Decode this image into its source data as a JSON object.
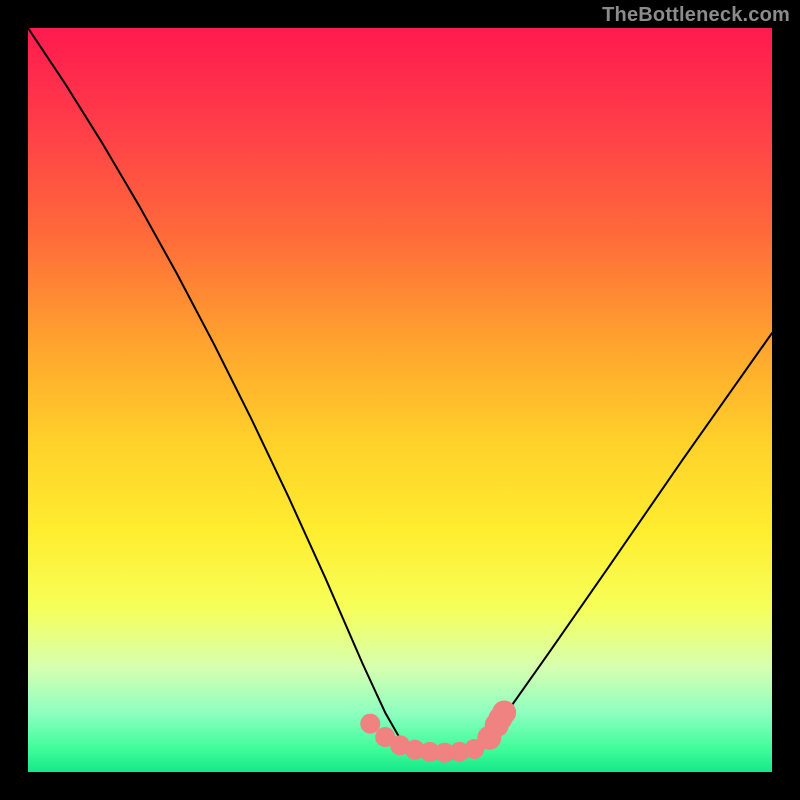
{
  "watermark": "TheBottleneck.com",
  "chart_data": {
    "type": "line",
    "title": "",
    "xlabel": "",
    "ylabel": "",
    "xlim": [
      0,
      100
    ],
    "ylim": [
      0,
      100
    ],
    "series": [
      {
        "name": "v-curve",
        "x": [
          0,
          5,
          10,
          15,
          20,
          25,
          30,
          35,
          40,
          45,
          48,
          50,
          53,
          56,
          58,
          60,
          62,
          64,
          70,
          78,
          88,
          100
        ],
        "values": [
          100,
          92.5,
          84.5,
          76,
          67,
          57.5,
          47.5,
          37,
          26,
          14.5,
          8,
          4.5,
          2.7,
          2.5,
          2.6,
          3.2,
          4.8,
          7.5,
          16,
          27.5,
          42,
          59
        ]
      }
    ],
    "markers": [
      {
        "name": "salmon-dot",
        "color": "#f08282",
        "x": [
          46,
          48,
          50,
          52,
          54,
          56,
          58,
          60,
          62,
          63,
          63.5,
          64
        ],
        "values": [
          6.5,
          4.7,
          3.6,
          3.0,
          2.7,
          2.6,
          2.7,
          3.1,
          4.6,
          6.3,
          7.2,
          8.0
        ],
        "radius": [
          10,
          10,
          10,
          10,
          10,
          10,
          10,
          10,
          12,
          12,
          12,
          12
        ]
      }
    ]
  }
}
